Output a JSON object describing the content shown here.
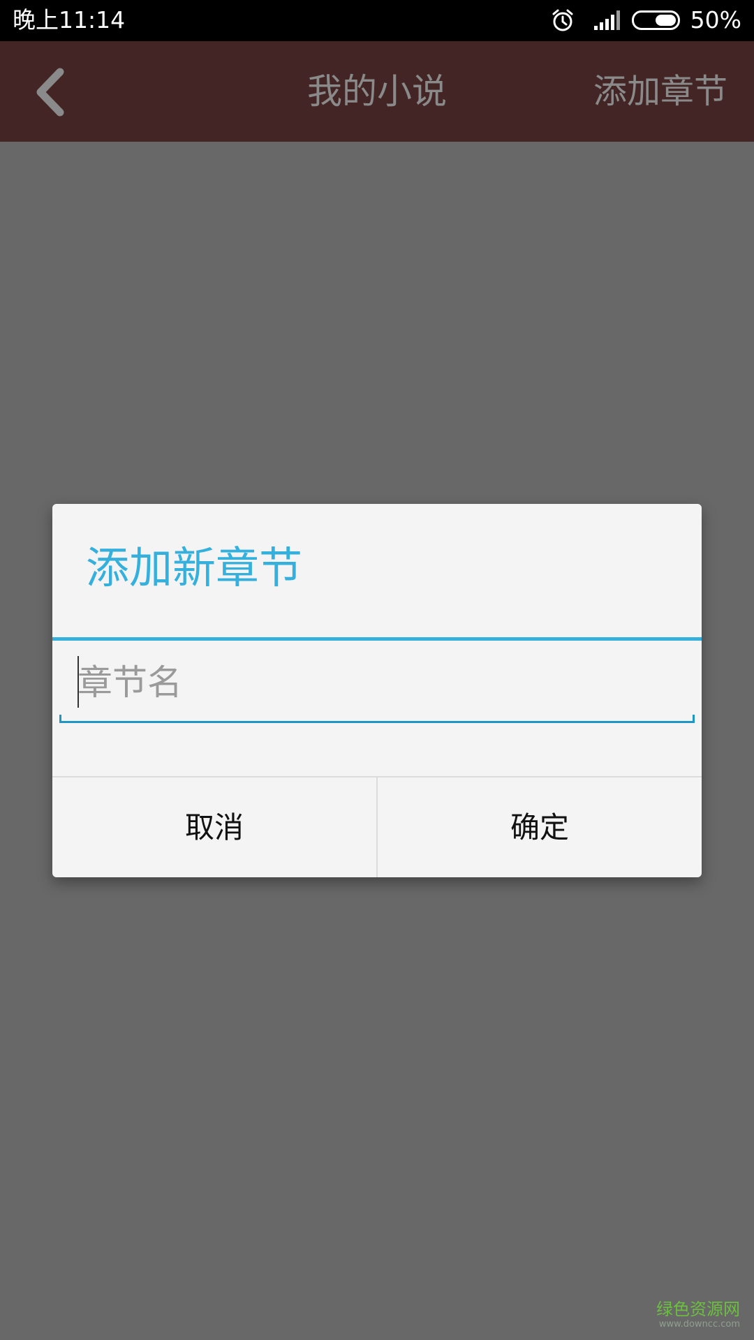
{
  "status_bar": {
    "time": "晚上11:14",
    "battery": "50%",
    "icons": [
      "alarm-icon",
      "signal-icon",
      "battery-icon"
    ]
  },
  "app_bar": {
    "back_icon": "chevron-left-icon",
    "title": "我的小说",
    "action": "添加章节"
  },
  "dialog": {
    "title": "添加新章节",
    "input_value": "",
    "input_placeholder": "章节名",
    "cancel_label": "取消",
    "confirm_label": "确定"
  },
  "watermark": {
    "main": "绿色资源网",
    "sub": "www.downcc.com"
  },
  "colors": {
    "status_bar": "#000000",
    "app_bar_dimmed": "#432525",
    "scrim": "#686868",
    "dialog_bg": "#f4f4f4",
    "accent": "#35b0dd",
    "input_underline": "#1e96c4",
    "watermark": "#6cbf3f"
  }
}
